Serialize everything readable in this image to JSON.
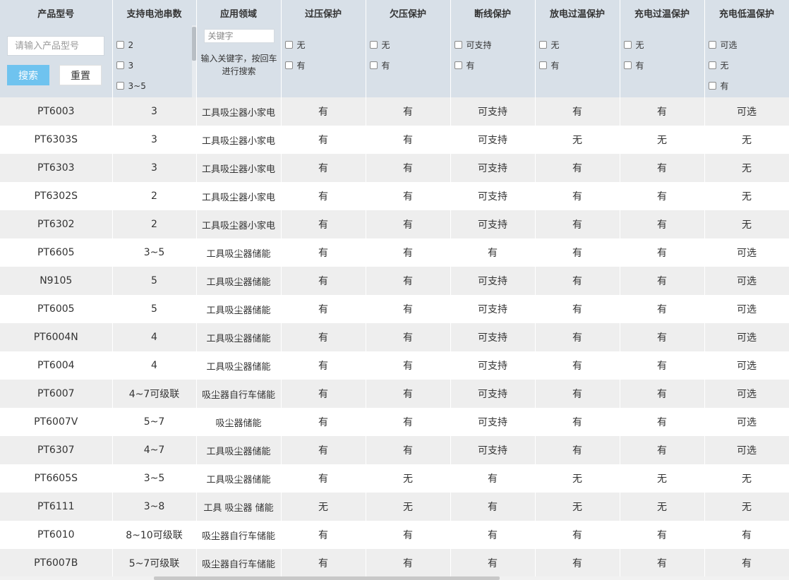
{
  "headers": [
    "产品型号",
    "支持电池串数",
    "应用领域",
    "过压保护",
    "欠压保护",
    "断线保护",
    "放电过温保护",
    "充电过温保护",
    "充电低温保护"
  ],
  "filters": {
    "model_search": {
      "placeholder": "请输入产品型号",
      "search_label": "搜索",
      "reset_label": "重置"
    },
    "cell_count_options": [
      "2",
      "3",
      "3~5"
    ],
    "application": {
      "keyword_placeholder": "关键字",
      "hint": "输入关键字，按回车进行搜索"
    },
    "overvoltage_options": [
      "无",
      "有"
    ],
    "undervoltage_options": [
      "无",
      "有"
    ],
    "disconnect_options": [
      "可支持",
      "有"
    ],
    "discharge_overtemp_options": [
      "无",
      "有"
    ],
    "charge_overtemp_options": [
      "无",
      "有"
    ],
    "charge_lowtemp_options": [
      "可选",
      "无",
      "有"
    ]
  },
  "rows": [
    [
      "PT6003",
      "3",
      "工具吸尘器小家电",
      "有",
      "有",
      "可支持",
      "有",
      "有",
      "可选"
    ],
    [
      "PT6303S",
      "3",
      "工具吸尘器小家电",
      "有",
      "有",
      "可支持",
      "无",
      "无",
      "无"
    ],
    [
      "PT6303",
      "3",
      "工具吸尘器小家电",
      "有",
      "有",
      "可支持",
      "有",
      "有",
      "无"
    ],
    [
      "PT6302S",
      "2",
      "工具吸尘器小家电",
      "有",
      "有",
      "可支持",
      "有",
      "有",
      "无"
    ],
    [
      "PT6302",
      "2",
      "工具吸尘器小家电",
      "有",
      "有",
      "可支持",
      "有",
      "有",
      "无"
    ],
    [
      "PT6605",
      "3~5",
      "工具吸尘器储能",
      "有",
      "有",
      "有",
      "有",
      "有",
      "可选"
    ],
    [
      "N9105",
      "5",
      "工具吸尘器储能",
      "有",
      "有",
      "可支持",
      "有",
      "有",
      "可选"
    ],
    [
      "PT6005",
      "5",
      "工具吸尘器储能",
      "有",
      "有",
      "可支持",
      "有",
      "有",
      "可选"
    ],
    [
      "PT6004N",
      "4",
      "工具吸尘器储能",
      "有",
      "有",
      "可支持",
      "有",
      "有",
      "可选"
    ],
    [
      "PT6004",
      "4",
      "工具吸尘器储能",
      "有",
      "有",
      "可支持",
      "有",
      "有",
      "可选"
    ],
    [
      "PT6007",
      "4~7可级联",
      "吸尘器自行车储能",
      "有",
      "有",
      "可支持",
      "有",
      "有",
      "可选"
    ],
    [
      "PT6007V",
      "5~7",
      "吸尘器储能",
      "有",
      "有",
      "可支持",
      "有",
      "有",
      "可选"
    ],
    [
      "PT6307",
      "4~7",
      "工具吸尘器储能",
      "有",
      "有",
      "可支持",
      "有",
      "有",
      "可选"
    ],
    [
      "PT6605S",
      "3~5",
      "工具吸尘器储能",
      "有",
      "无",
      "有",
      "无",
      "无",
      "无"
    ],
    [
      "PT6111",
      "3~8",
      "工具 吸尘器 储能",
      "无",
      "无",
      "有",
      "无",
      "无",
      "无"
    ],
    [
      "PT6010",
      "8~10可级联",
      "吸尘器自行车储能",
      "有",
      "有",
      "有",
      "有",
      "有",
      "有"
    ],
    [
      "PT6007B",
      "5~7可级联",
      "吸尘器自行车储能",
      "有",
      "有",
      "有",
      "有",
      "有",
      "有"
    ]
  ]
}
